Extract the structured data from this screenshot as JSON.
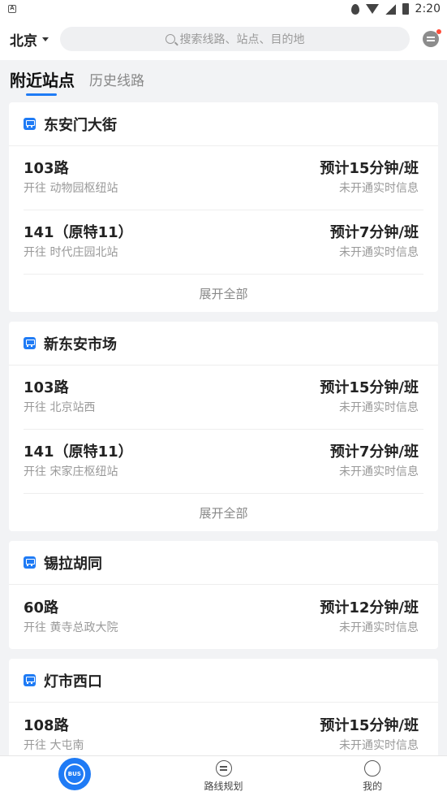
{
  "status_bar": {
    "time": "2:20"
  },
  "header": {
    "city": "北京",
    "search_placeholder": "搜索线路、站点、目的地"
  },
  "tabs": [
    {
      "label": "附近站点",
      "active": true
    },
    {
      "label": "历史线路",
      "active": false
    }
  ],
  "stations": [
    {
      "name": "东安门大街",
      "routes": [
        {
          "name": "103路",
          "dest": "开往 动物园枢纽站",
          "eta": "预计15分钟/班",
          "realtime": "未开通实时信息"
        },
        {
          "name": "141（原特11）",
          "dest": "开往 时代庄园北站",
          "eta": "预计7分钟/班",
          "realtime": "未开通实时信息"
        }
      ],
      "expand": "展开全部"
    },
    {
      "name": "新东安市场",
      "routes": [
        {
          "name": "103路",
          "dest": "开往 北京站西",
          "eta": "预计15分钟/班",
          "realtime": "未开通实时信息"
        },
        {
          "name": "141（原特11）",
          "dest": "开往 宋家庄枢纽站",
          "eta": "预计7分钟/班",
          "realtime": "未开通实时信息"
        }
      ],
      "expand": "展开全部"
    },
    {
      "name": "锡拉胡同",
      "routes": [
        {
          "name": "60路",
          "dest": "开往 黄寺总政大院",
          "eta": "预计12分钟/班",
          "realtime": "未开通实时信息"
        }
      ]
    },
    {
      "name": "灯市西口",
      "routes": [
        {
          "name": "108路",
          "dest": "开往 大屯南",
          "eta": "预计15分钟/班",
          "realtime": "未开通实时信息"
        }
      ]
    }
  ],
  "bottom_nav": {
    "bus_label": "BUS",
    "route_plan": "路线规划",
    "me": "我的"
  },
  "colors": {
    "accent": "#1f7bf5",
    "badge": "#ff4d3a"
  }
}
